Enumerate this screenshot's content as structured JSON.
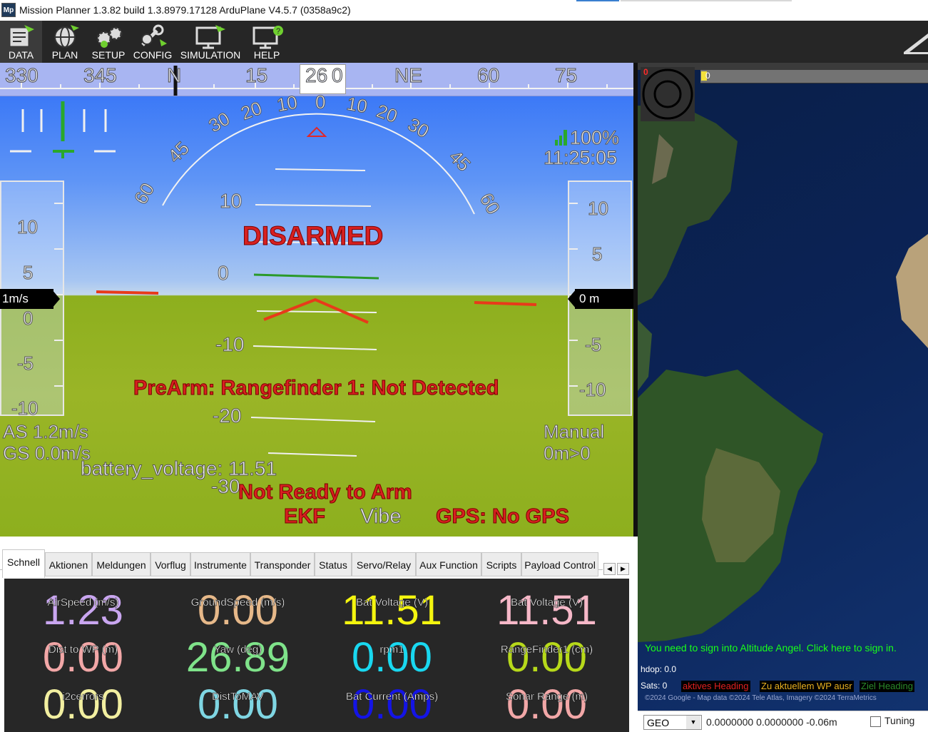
{
  "window": {
    "logo_text": "Mp",
    "title": "Mission Planner 1.3.82 build 1.3.8979.17128 ArduPlane V4.5.7 (0358a9c2)"
  },
  "menu": {
    "items": [
      {
        "label": "DATA",
        "icon": "data-icon"
      },
      {
        "label": "PLAN",
        "icon": "globe-icon"
      },
      {
        "label": "SETUP",
        "icon": "setup-gears-icon"
      },
      {
        "label": "CONFIG",
        "icon": "wrench-icon"
      },
      {
        "label": "SIMULATION",
        "icon": "monitor-plane-icon"
      },
      {
        "label": "HELP",
        "icon": "monitor-help-icon"
      }
    ],
    "brand_icon": "mission-planner-brand-icon"
  },
  "hud": {
    "compass": [
      "330",
      "345",
      "N",
      "15",
      "0",
      "NE",
      "60",
      "75"
    ],
    "heading_value": "26",
    "roll_scale": [
      "60",
      "45",
      "30",
      "20",
      "10",
      "0",
      "10",
      "20",
      "30",
      "45",
      "60"
    ],
    "pitch_scale": [
      "10",
      "0",
      "-10",
      "-20",
      "-30"
    ],
    "battery_percent": "100%",
    "time": "11:25:05",
    "status": "DISARMED",
    "prearm_message": "PreArm: Rangefinder 1: Not Detected",
    "not_ready": "Not Ready to Arm",
    "ekf": "EKF",
    "vibe": "Vibe",
    "gps": "GPS: No GPS",
    "airspeed": "AS 1.2m/s",
    "groundspeed": "GS 0.0m/s",
    "battery_voltage": "battery_voltage: 11.51",
    "mode": "Manual",
    "wp_distance": "0m>0",
    "speed_tape": [
      "10",
      "5",
      "0",
      "-5",
      "-10"
    ],
    "speed_readout": "1m/s",
    "alt_tape": [
      "10",
      "5",
      "-5",
      "-10"
    ],
    "alt_readout": "0 m",
    "colors": {
      "sky_top": "#2e6ef7",
      "ground": "#9ab527",
      "alert_red": "#d72020"
    }
  },
  "tabs": [
    "Schnell",
    "Aktionen",
    "Meldungen",
    "Vorflug",
    "Instrumente",
    "Transponder",
    "Status",
    "Servo/Relay",
    "Aux Function",
    "Scripts",
    "Payload Control"
  ],
  "quick": [
    {
      "label": "AirSpeed (m/s)",
      "value": "1.23",
      "color": "#c9a6f0"
    },
    {
      "label": "GroundSpeed (m/s)",
      "value": "0.00",
      "color": "#e6b889"
    },
    {
      "label": "Bat Voltage (V)",
      "value": "11.51",
      "color": "#f4f50f"
    },
    {
      "label": "Bat Voltage (V)",
      "value": "11.51",
      "color": "#f6b8c8"
    },
    {
      "label": "Dist to WP (m)",
      "value": "0.00",
      "color": "#f2a7a7"
    },
    {
      "label": "Yaw (deg)",
      "value": "26.89",
      "color": "#7fe38a"
    },
    {
      "label": "rpm1",
      "value": "0.00",
      "color": "#19d8f0"
    },
    {
      "label": "RangeFinder1 (cm)",
      "value": "0.00",
      "color": "#b7d91a"
    },
    {
      "label": "i2cerrors",
      "value": "0.00",
      "color": "#f2efa0"
    },
    {
      "label": "DistToMAV",
      "value": "0.00",
      "color": "#7fd6e3"
    },
    {
      "label": "Bat Current (Amps)",
      "value": "0.00",
      "color": "#1414e6"
    },
    {
      "label": "Sonar Range (m)",
      "value": "0.00",
      "color": "#f2a7a7"
    }
  ],
  "map": {
    "corner_red": "0",
    "bar_value": "0",
    "notice": "You need to sign into Altitude Angel. Click here to sign in.",
    "hdop": "hdop: 0.0",
    "sats": "Sats: 0",
    "legend": [
      "aktives Heading",
      "Zu aktuellem WP ausr",
      "Ziel Heading"
    ],
    "copyright": "©2024 Google - Map data ©2024 Tele Atlas, Imagery ©2024 TerraMetrics",
    "coord_mode": "GEO",
    "coords": "0.0000000 0.0000000  -0.06m",
    "tuning": "Tuning"
  }
}
